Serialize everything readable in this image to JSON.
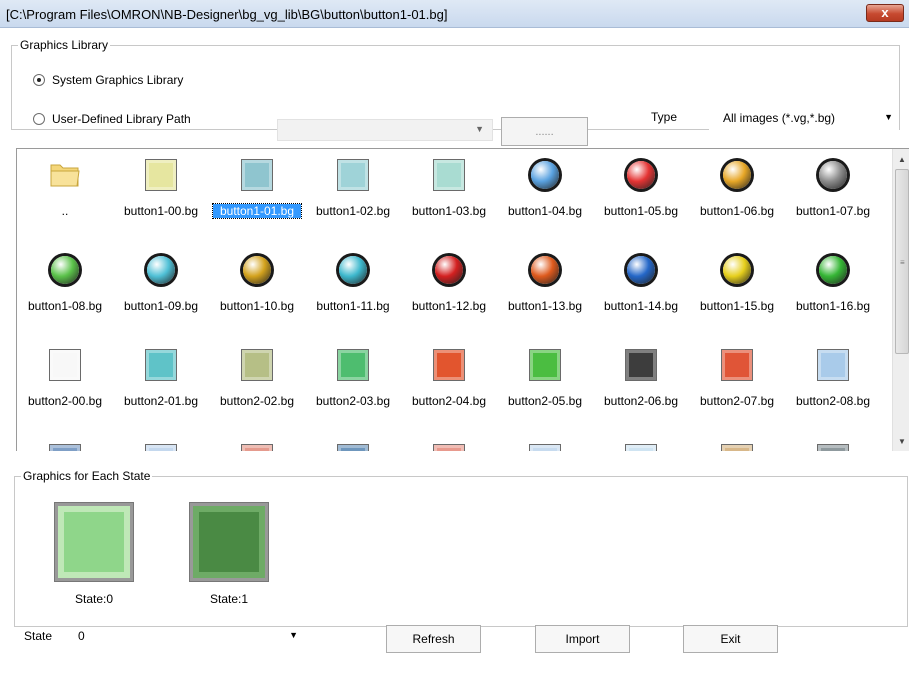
{
  "title_bar": {
    "title": "[C:\\Program Files\\OMRON\\NB-Designer\\bg_vg_lib\\BG\\button\\button1-01.bg]",
    "close_label": "x"
  },
  "library": {
    "legend": "Graphics Library",
    "system_label": "System Graphics Library",
    "user_label": "User-Defined Library Path",
    "path_value": "",
    "browse_label": "......",
    "type_label": "Type",
    "type_value": "All images (*.vg,*.bg)",
    "selected_option": "system"
  },
  "files": [
    {
      "label": "..",
      "kind": "folder",
      "color": "#f2d874"
    },
    {
      "label": "button1-00.bg",
      "kind": "square",
      "color": "#e6e6a0"
    },
    {
      "label": "button1-01.bg",
      "kind": "square",
      "color": "#8fc5cf",
      "selected": true
    },
    {
      "label": "button1-02.bg",
      "kind": "square",
      "color": "#9fd3d8"
    },
    {
      "label": "button1-03.bg",
      "kind": "square",
      "color": "#a9dcd2"
    },
    {
      "label": "button1-04.bg",
      "kind": "round",
      "color": "#5aa2e0"
    },
    {
      "label": "button1-05.bg",
      "kind": "round",
      "color": "#e53434"
    },
    {
      "label": "button1-06.bg",
      "kind": "round",
      "color": "#e7a727"
    },
    {
      "label": "button1-07.bg",
      "kind": "round",
      "color": "#8d8d8d"
    },
    {
      "label": "button1-08.bg",
      "kind": "round",
      "color": "#5bc24a"
    },
    {
      "label": "button1-09.bg",
      "kind": "round",
      "color": "#4fc0d6"
    },
    {
      "label": "button1-10.bg",
      "kind": "round",
      "color": "#d3a21d"
    },
    {
      "label": "button1-11.bg",
      "kind": "round",
      "color": "#3db8cd"
    },
    {
      "label": "button1-12.bg",
      "kind": "round",
      "color": "#d42020"
    },
    {
      "label": "button1-13.bg",
      "kind": "round",
      "color": "#de5a1d"
    },
    {
      "label": "button1-14.bg",
      "kind": "round",
      "color": "#2467c8"
    },
    {
      "label": "button1-15.bg",
      "kind": "round",
      "color": "#e6cf1c"
    },
    {
      "label": "button1-16.bg",
      "kind": "round",
      "color": "#35b635"
    },
    {
      "label": "button2-00.bg",
      "kind": "square",
      "color": "#f8f8f8"
    },
    {
      "label": "button2-01.bg",
      "kind": "square",
      "color": "#5fc3c8"
    },
    {
      "label": "button2-02.bg",
      "kind": "square",
      "color": "#b6bf86"
    },
    {
      "label": "button2-03.bg",
      "kind": "square",
      "color": "#4ebd6f"
    },
    {
      "label": "button2-04.bg",
      "kind": "square",
      "color": "#e2552e"
    },
    {
      "label": "button2-05.bg",
      "kind": "square",
      "color": "#4bbd41"
    },
    {
      "label": "button2-06.bg",
      "kind": "square",
      "color": "#3d3d3d"
    },
    {
      "label": "button2-07.bg",
      "kind": "square",
      "color": "#e05537"
    },
    {
      "label": "button2-08.bg",
      "kind": "square",
      "color": "#a9cbea"
    },
    {
      "label": "",
      "kind": "square",
      "color": "#7f9fc6"
    },
    {
      "label": "",
      "kind": "square",
      "color": "#c4d8ee"
    },
    {
      "label": "",
      "kind": "square",
      "color": "#e59b8e"
    },
    {
      "label": "",
      "kind": "square",
      "color": "#6f97bd"
    },
    {
      "label": "",
      "kind": "square",
      "color": "#e89a8e"
    },
    {
      "label": "",
      "kind": "square",
      "color": "#c7dbef"
    },
    {
      "label": "",
      "kind": "square",
      "color": "#cfe4f2"
    },
    {
      "label": "",
      "kind": "square",
      "color": "#d8b88a"
    },
    {
      "label": "",
      "kind": "square",
      "color": "#8f9a9e"
    }
  ],
  "states": {
    "legend": "Graphics for Each State",
    "items": [
      {
        "label": "State:0",
        "color": "#8fd68a",
        "border": "#bfe8b7"
      },
      {
        "label": "State:1",
        "color": "#4a8a44",
        "border": "#6eab66"
      }
    ]
  },
  "footer": {
    "state_label": "State",
    "state_value": "0",
    "refresh_label": "Refresh",
    "import_label": "Import",
    "exit_label": "Exit"
  },
  "icons": {
    "folder": "folder-icon",
    "dropdown": "chevron-down-icon",
    "scroll_up": "scroll-up-arrow-icon",
    "scroll_down": "scroll-down-arrow-icon"
  }
}
